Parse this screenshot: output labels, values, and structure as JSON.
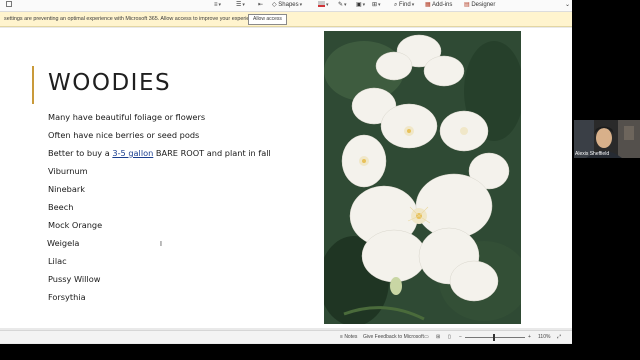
{
  "ribbon": {
    "shapes_label": "Shapes",
    "find_label": "Find",
    "addins_label": "Add-ins",
    "designer_label": "Designer"
  },
  "message_bar": {
    "text": "settings are preventing an optimal experience with Microsoft 365. Allow access to improve your experience.",
    "button_label": "Allow access"
  },
  "slide": {
    "title": "WOODIES",
    "bullets": [
      "Many have beautiful foliage or flowers",
      "Often have nice berries or seed pods",
      "Better to buy a ",
      "Viburnum",
      "Ninebark",
      "Beech",
      "Mock Orange",
      "Weigela",
      "Lilac",
      "Pussy Willow",
      "Forsythia"
    ],
    "bullet3_link": "3-5 gallon",
    "bullet3_rest": " BARE ROOT and plant in fall"
  },
  "status_bar": {
    "notes_label": "Notes",
    "feedback_label": "Give Feedback to Microsoft",
    "zoom_label": "110%"
  },
  "participant": {
    "name": "Alexis Sheffield"
  },
  "colors": {
    "accent_bar": "#c99a3a",
    "message_bar_bg": "#fff4ce",
    "title_text": "#1f1f1f"
  }
}
